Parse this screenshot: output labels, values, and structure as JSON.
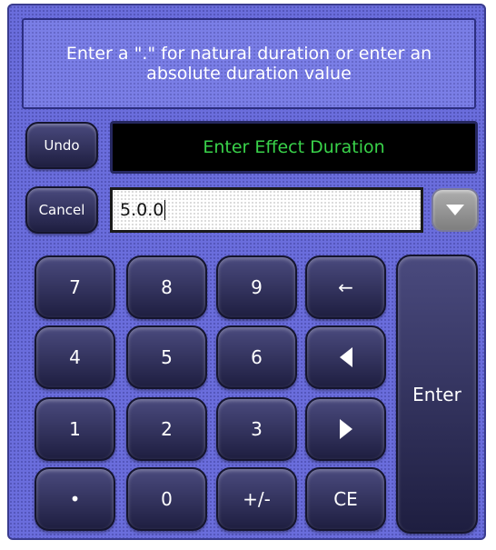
{
  "prompt": {
    "text": "Enter a \".\" for natural duration or enter an\nabsolute duration value"
  },
  "buttons": {
    "undo_label": "Undo",
    "cancel_label": "Cancel"
  },
  "field": {
    "title": "Enter Effect Duration",
    "value": "5.0.0"
  },
  "dropdown": {
    "icon": "triangle-down-icon"
  },
  "keypad": {
    "key_7": "7",
    "key_8": "8",
    "key_9": "9",
    "key_backspace": "←",
    "key_4": "4",
    "key_5": "5",
    "key_6": "6",
    "key_1": "1",
    "key_2": "2",
    "key_3": "3",
    "key_dot": "•",
    "key_0": "0",
    "key_plusminus": "+/-",
    "key_ce": "CE",
    "key_enter": "Enter",
    "icons": {
      "left": "triangle-left-icon",
      "right": "triangle-right-icon"
    }
  },
  "colors": {
    "panel": "#6a6ddc",
    "title_text": "#39d24a",
    "title_bg": "#000000"
  }
}
